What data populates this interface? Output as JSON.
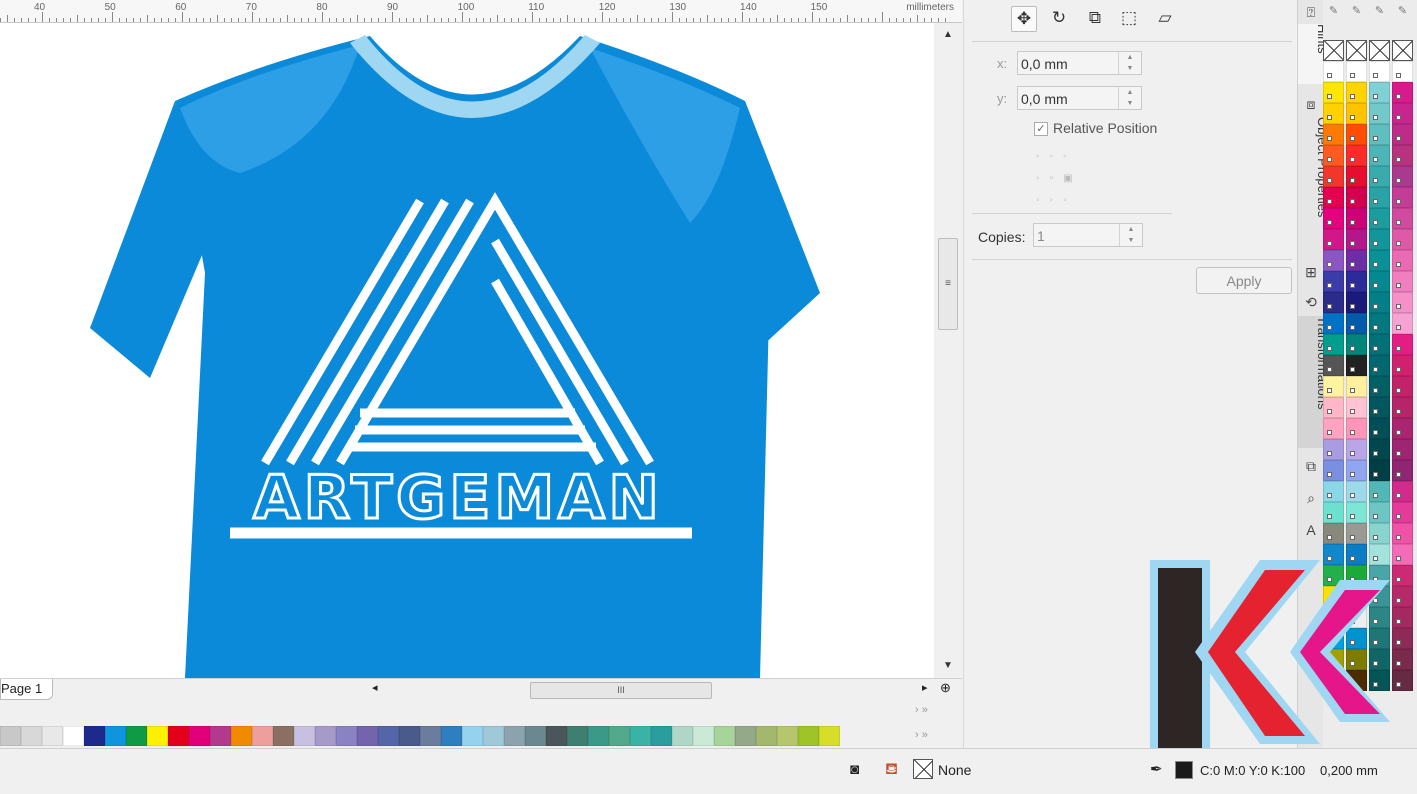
{
  "ruler": {
    "labels": [
      "40",
      "50",
      "60",
      "70",
      "80",
      "90",
      "100",
      "110",
      "120",
      "130",
      "140",
      "150"
    ],
    "unit": "millimeters"
  },
  "artwork": {
    "logo_text": "ARTGEMAN",
    "shirt_color": "#0a8ad8",
    "collar_color": "#9fd6f2"
  },
  "page_tab": {
    "label": "Page 1"
  },
  "transform_docker": {
    "x_label": "x:",
    "x_value": "0,0 mm",
    "y_label": "y:",
    "y_value": "0,0 mm",
    "relative_position_label": "Relative Position",
    "relative_position_checked": true,
    "copies_label": "Copies:",
    "copies_value": "1",
    "apply_label": "Apply",
    "toolbar_icons": [
      "position-icon",
      "rotate-icon",
      "scale-mirror-icon",
      "size-icon",
      "skew-icon"
    ]
  },
  "side_tabs": [
    "Hints",
    "Object Properties",
    "Transformations"
  ],
  "status_bar": {
    "fill_value": "None",
    "outline_color": "C:0 M:0 Y:0 K:100",
    "outline_width": "0,200 mm"
  },
  "bottom_palette": [
    "#c8c8c8",
    "#d8d8d8",
    "#e8e8e8",
    "#ffffff",
    "#1d2a8c",
    "#0f95dd",
    "#0f9a45",
    "#ffef00",
    "#e3001b",
    "#e2007a",
    "#b23a8e",
    "#f08a00",
    "#ef9e9e",
    "#8b6f63",
    "#c8c0e0",
    "#a59ac8",
    "#8a82c3",
    "#7463ad",
    "#5566a8",
    "#4a5a8a",
    "#6b7c9c",
    "#2e7fc0",
    "#95d2ee",
    "#9fc8d8",
    "#8ca3ad",
    "#6b8890",
    "#4a565c",
    "#3e7f72",
    "#3a9988",
    "#52a98c",
    "#3bb2a6",
    "#2a9e9e",
    "#b0d6c8",
    "#cae9d6",
    "#a7d49a",
    "#94a98a",
    "#a3b86d",
    "#b6c66c",
    "#9ec42a",
    "#d6de2a"
  ],
  "right_palette": {
    "col1": [
      "#ffe600",
      "#ffd100",
      "#ff7a00",
      "#ff5a1f",
      "#f2362b",
      "#e50050",
      "#e5007e",
      "#d1178a",
      "#8b55c4",
      "#3b3ca8",
      "#2b2c8a",
      "#0072c6",
      "#009e8c",
      "#555555",
      "#fff3a0",
      "#ffb6c8",
      "#ffa3c1",
      "#a99ce0",
      "#7a8fe0",
      "#8ad7e8",
      "#6ee0d0",
      "#88887d",
      "#1188cc",
      "#23b04b",
      "#ffdf00",
      "#d9d9d9",
      "#00a3e0",
      "#a0a000",
      "#6d3b00"
    ],
    "col2": [
      "#ffd400",
      "#ffc400",
      "#ff4e00",
      "#ff2a2a",
      "#e60d2e",
      "#d3004f",
      "#cc0077",
      "#b4168c",
      "#6c2da6",
      "#2d2a99",
      "#1a1a7a",
      "#005ba8",
      "#00857a",
      "#222222",
      "#fff0a0",
      "#ffc3d3",
      "#ff95b8",
      "#b8a6e6",
      "#90a6f0",
      "#9cd9ea",
      "#7ee6d7",
      "#9a9a95",
      "#0b7dc4",
      "#1aaa3a",
      "#ffea00",
      "#eeeeee",
      "#0091cf",
      "#7c7c00",
      "#4d2a00"
    ],
    "col3": [
      "#7fd1d5",
      "#73c8c9",
      "#5fbfbe",
      "#4cb5b7",
      "#3aabad",
      "#2aa3a8",
      "#1b9c9f",
      "#11969a",
      "#0a9097",
      "#05888f",
      "#038087",
      "#02787f",
      "#027077",
      "#01686f",
      "#015f66",
      "#01575e",
      "#014f56",
      "#01474e",
      "#013f46",
      "#52b7b7",
      "#6dc6c3",
      "#88d5d0",
      "#a3e3dd",
      "#48a6a6",
      "#3a9696",
      "#2c8686",
      "#1e7676",
      "#106666",
      "#045656"
    ],
    "col4": [
      "#d81b8c",
      "#c8268f",
      "#bd2c88",
      "#b8327f",
      "#a93a8f",
      "#c33c96",
      "#d04aa0",
      "#de5aa9",
      "#ea6bb3",
      "#f07fbf",
      "#f591c9",
      "#f6a3d3",
      "#e41d84",
      "#d1206e",
      "#c3226a",
      "#b6246a",
      "#a92570",
      "#9d2572",
      "#902574",
      "#d12b8c",
      "#e43a9a",
      "#ee52a9",
      "#f46cb8",
      "#cc2a74",
      "#b72a6a",
      "#a22a60",
      "#8e2a56",
      "#7a2a4c",
      "#662a42"
    ]
  }
}
